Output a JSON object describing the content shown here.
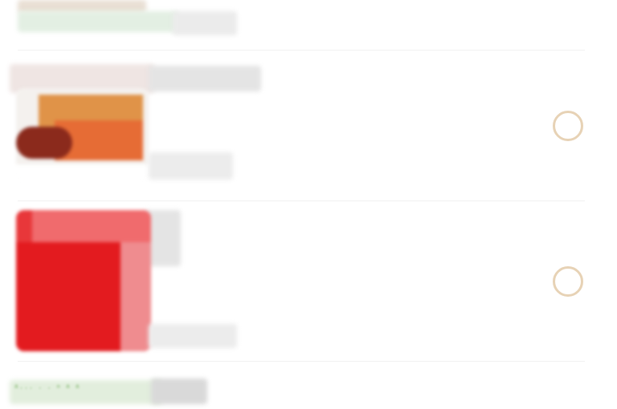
{
  "colors": {
    "radio_border": "#e7d2b5",
    "divider": "#f1f1f1",
    "item2_primary": "#e31b1f",
    "item1_primary": "#e0743a"
  },
  "items": [
    {
      "name": "product-item-1",
      "selected": false,
      "title": "",
      "subtitle": "",
      "price": ""
    },
    {
      "name": "product-item-2",
      "selected": false,
      "title": "",
      "subtitle": "",
      "price": ""
    }
  ],
  "footer": {
    "caption": "ᵃ··· ·  · ⁿ ᵃ ᵃ"
  }
}
